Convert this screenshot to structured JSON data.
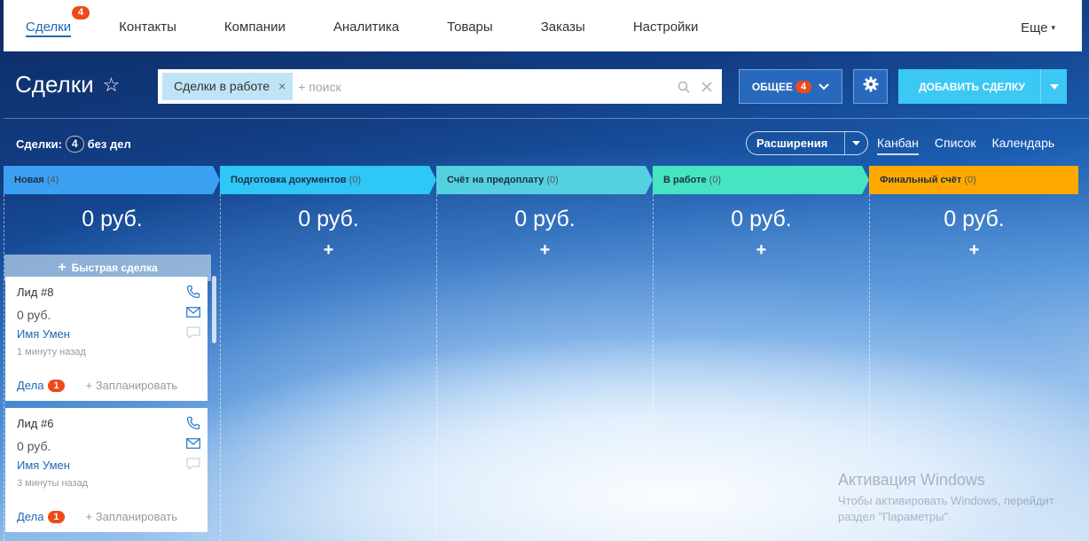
{
  "nav": {
    "tabs": [
      "Сделки",
      "Контакты",
      "Компании",
      "Аналитика",
      "Товары",
      "Заказы",
      "Настройки"
    ],
    "deals_badge": "4",
    "more": "Еще"
  },
  "header": {
    "title": "Сделки",
    "filter_chip": "Сделки в работе",
    "search_placeholder": "+ поиск",
    "general_label": "ОБЩЕЕ",
    "general_count": "4",
    "add_label": "ДОБАВИТЬ СДЕЛКУ"
  },
  "toolbar": {
    "deals_label": "Сделки:",
    "deals_count": "4",
    "deals_suffix": "без дел",
    "extensions": "Расширения",
    "views": [
      "Канбан",
      "Список",
      "Календарь"
    ]
  },
  "colors": {
    "stage_new": "#3ba0f2",
    "stage_docs": "#2fc7f7",
    "stage_invoice": "#55d0e0",
    "stage_work": "#47e4c2",
    "stage_final": "#ffa900"
  },
  "columns": [
    {
      "title": "Новая",
      "count": "(4)",
      "sum": "0 руб."
    },
    {
      "title": "Подготовка документов",
      "count": "(0)",
      "sum": "0 руб."
    },
    {
      "title": "Счёт на предоплату",
      "count": "(0)",
      "sum": "0 руб."
    },
    {
      "title": "В работе",
      "count": "(0)",
      "sum": "0 руб."
    },
    {
      "title": "Финальный счёт",
      "count": "(0)",
      "sum": "0 руб."
    }
  ],
  "quick_deal": "Быстрая сделка",
  "cards": [
    {
      "title": "Лид #8",
      "sum": "0 руб.",
      "client": "Имя Умен",
      "time": "1 минуту назад",
      "acts": "Дела",
      "acts_count": "1",
      "plan": "+ Запланировать"
    },
    {
      "title": "Лид #6",
      "sum": "0 руб.",
      "client": "Имя Умен",
      "time": "3 минуты назад",
      "acts": "Дела",
      "acts_count": "1",
      "plan": "+ Запланировать"
    }
  ],
  "watermark": {
    "title": "Активация Windows",
    "line1": "Чтобы активировать Windows, перейдит",
    "line2": "раздел \"Параметры\"."
  }
}
